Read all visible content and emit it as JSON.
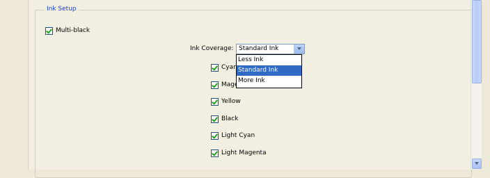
{
  "ink_setup": {
    "legend": "Ink Setup",
    "multiblack": {
      "label": "Multi-black",
      "checked": true
    },
    "ink_coverage": {
      "label": "Ink Coverage:",
      "selected": "Standard Ink",
      "options": [
        "Less Ink",
        "Standard Ink",
        "More Ink"
      ]
    },
    "inks": [
      {
        "label": "Cyan",
        "checked": true
      },
      {
        "label": "Magenta",
        "checked": true
      },
      {
        "label": "Yellow",
        "checked": true
      },
      {
        "label": "Black",
        "checked": true
      },
      {
        "label": "Light Cyan",
        "checked": true
      },
      {
        "label": "Light Magenta",
        "checked": true
      }
    ]
  }
}
